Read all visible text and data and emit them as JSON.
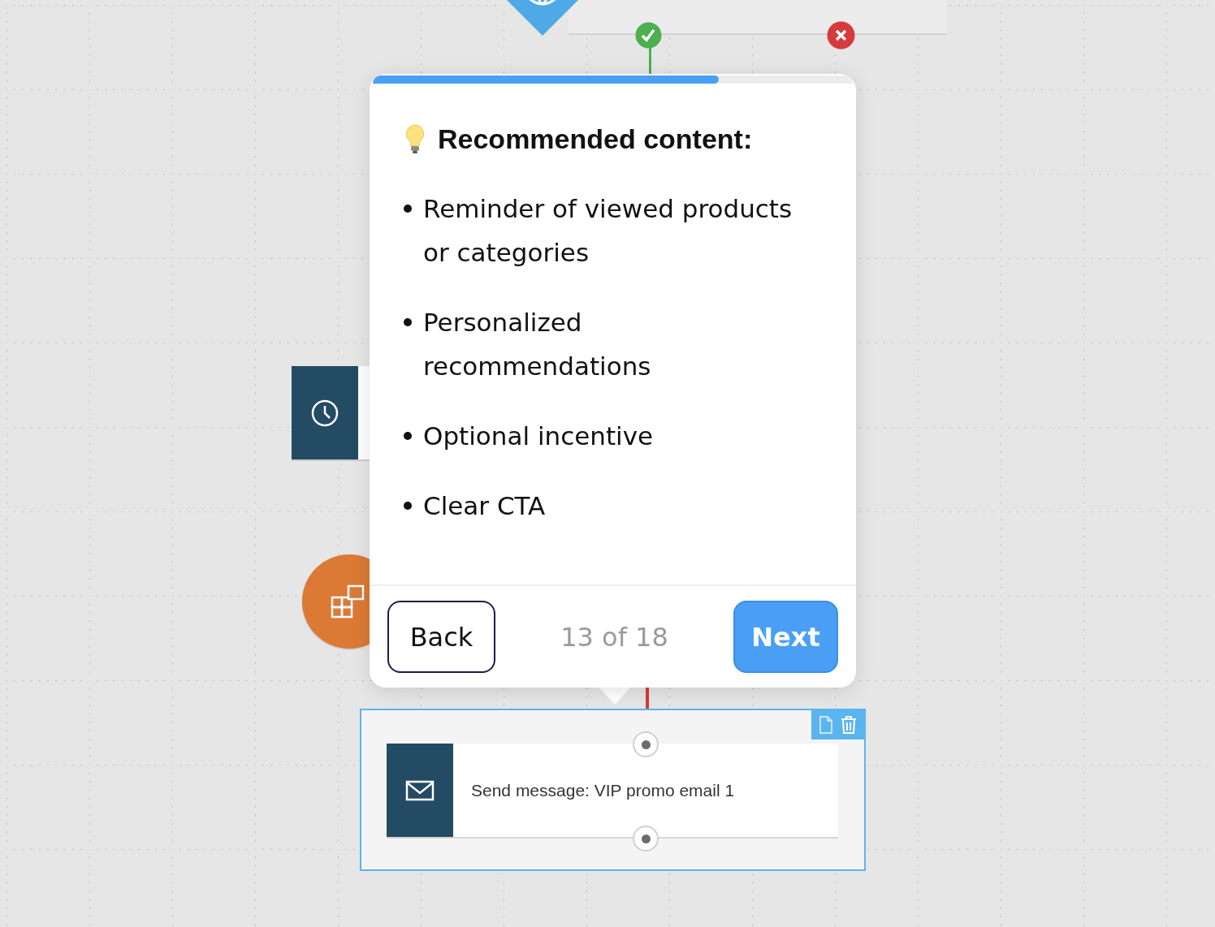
{
  "canvas": {
    "send_node": {
      "label": "Send message: VIP promo email 1",
      "selected": true
    }
  },
  "tour_popover": {
    "progress": {
      "level": 0.72
    },
    "title": "Recommended content:",
    "items": [
      "Reminder of viewed products or categories",
      "Personalized recommendations",
      "Optional incentive",
      "Clear CTA"
    ],
    "back_button": "Back",
    "step_counter": "13 of 18",
    "next_button": "Next"
  }
}
